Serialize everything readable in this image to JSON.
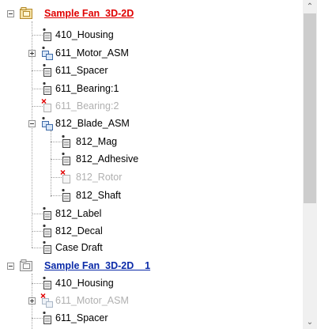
{
  "tree": {
    "root1": {
      "label": "Sample Fan_3D-2D"
    },
    "items1": [
      "410_Housing",
      "611_Motor_ASM",
      "611_Spacer",
      "611_Bearing:1",
      "611_Bearing:2",
      "812_Blade_ASM",
      "812_Mag",
      "812_Adhesive",
      "812_Rotor",
      "812_Shaft",
      "812_Label",
      "812_Decal",
      "Case Draft"
    ],
    "root2": {
      "label": "Sample Fan_3D-2D__1"
    },
    "items2": [
      "410_Housing",
      "611_Motor_ASM",
      "611_Spacer"
    ]
  },
  "scrollbar": {
    "up": "⌃",
    "down": "⌄"
  }
}
